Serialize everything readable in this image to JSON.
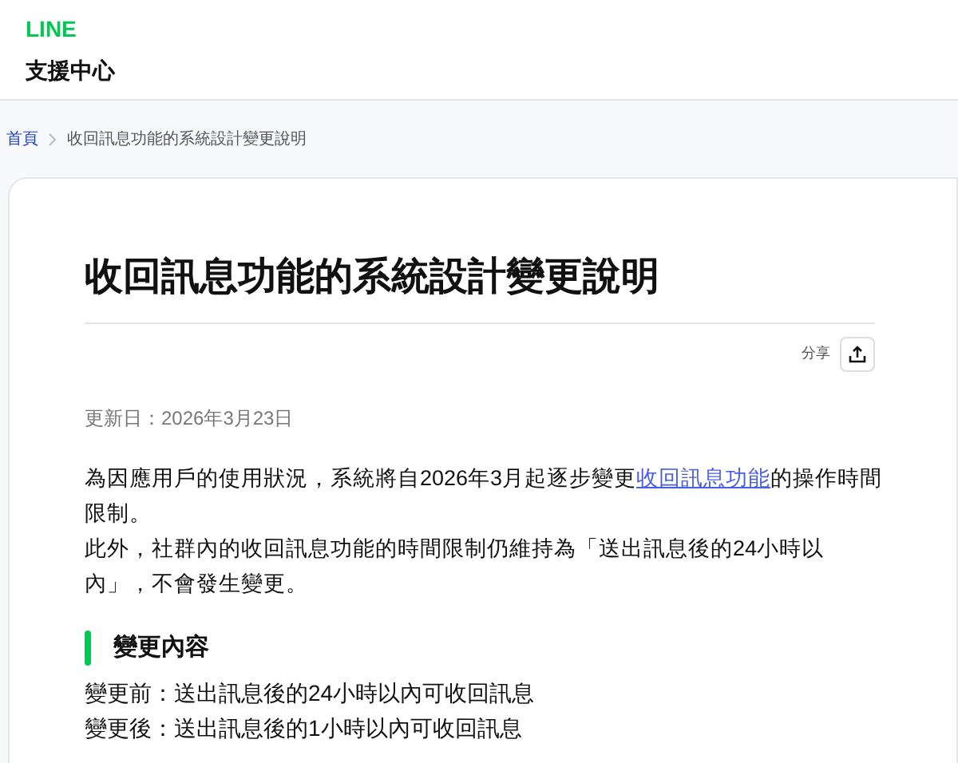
{
  "header": {
    "logo": "LINE",
    "title": "支援中心"
  },
  "breadcrumb": [
    {
      "label": "首頁",
      "link": true
    },
    {
      "label": "收回訊息功能的系統設計變更說明",
      "link": false
    }
  ],
  "article": {
    "title": "收回訊息功能的系統設計變更說明",
    "share_label": "分享",
    "updated": "更新日：2026年3月23日",
    "paragraphs": [
      {
        "before": "為因應用戶的使用狀況，系統將自2026年3月起逐步變更",
        "link": "收回訊息功能",
        "after": "的操作時間限制。"
      },
      {
        "before": "此外，社群內的收回訊息功能的時間限制仍維持為「送出訊息後的24小時以內」，不會發生變更。"
      }
    ],
    "section_heading": "變更內容",
    "lines": [
      "變更前：送出訊息後的24小時以內可收回訊息",
      "變更後：送出訊息後的1小時以內可收回訊息"
    ]
  }
}
